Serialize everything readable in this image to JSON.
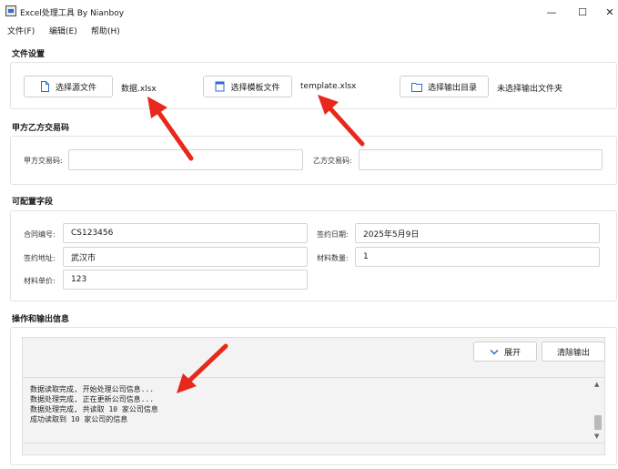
{
  "window": {
    "title": "Excel处理工具 By Nianboy",
    "minimize_glyph": "—",
    "maximize_glyph": "☐",
    "close_glyph": "✕"
  },
  "menu": [
    {
      "label": "文件(F)"
    },
    {
      "label": "编辑(E)"
    },
    {
      "label": "帮助(H)"
    }
  ],
  "file_settings": {
    "title": "文件设置",
    "source_button": "选择源文件",
    "source_value": "数据.xlsx",
    "template_button": "选择模板文件",
    "template_value": "template.xlsx",
    "output_button": "选择输出目录",
    "output_value": "未选择输出文件夹"
  },
  "trade_codes": {
    "title": "甲方乙方交易码",
    "party_a_label": "甲方交易码:",
    "party_a_value": "",
    "party_b_label": "乙方交易码:",
    "party_b_value": ""
  },
  "config_fields": {
    "title": "可配置字段",
    "contract_no_label": "合同编号:",
    "contract_no_value": "CS123456",
    "sign_date_label": "签约日期:",
    "sign_date_value": "2025年5月9日",
    "sign_place_label": "签约地址:",
    "sign_place_value": "武汉市",
    "material_qty_label": "材料数量:",
    "material_qty_value": "1",
    "unit_price_label": "材料单价:",
    "unit_price_value": "123"
  },
  "operations": {
    "title": "操作和输出信息",
    "expand_button": "展开",
    "clear_button": "清除输出",
    "log_lines": [
      "数据读取完成, 开始处理公司信息...",
      "数据处理完成, 正在更新公司信息...",
      "数据处理完成, 共读取 10 家公司信息",
      "成功读取到 10 家公司的信息"
    ]
  },
  "colors": {
    "arrow_red": "#e8281c",
    "button_icon_blue": "#2e6bd8",
    "title_bar_bg": "#ffffff"
  }
}
